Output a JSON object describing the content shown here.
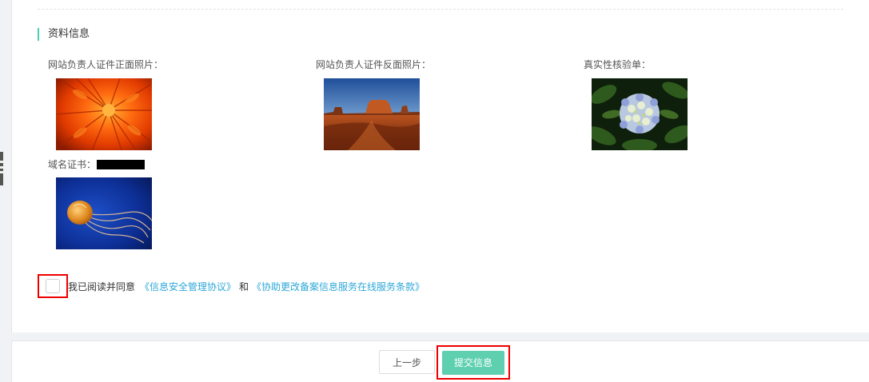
{
  "section": {
    "title": "资料信息"
  },
  "fields": {
    "front_photo": {
      "label": "网站负责人证件正面照片：",
      "image": "chrysanthemum-photo"
    },
    "back_photo": {
      "label": "网站负责人证件反面照片：",
      "image": "desert-mesa-photo"
    },
    "verification": {
      "label": "真实性核验单：",
      "image": "hydrangea-photo"
    },
    "domain_cert": {
      "label": "域名证书：",
      "image": "jellyfish-photo"
    }
  },
  "agreement": {
    "text": "我已阅读并同意",
    "link1": "《信息安全管理协议》",
    "and": "和",
    "link2": "《协助更改备案信息服务在线服务条款》",
    "checked": false
  },
  "footer": {
    "prev_label": "上一步",
    "submit_label": "提交信息"
  },
  "colors": {
    "accent": "#4ecdb3",
    "submit": "#5ed0b0",
    "link": "#2ea8d8",
    "highlight": "#e00000"
  }
}
